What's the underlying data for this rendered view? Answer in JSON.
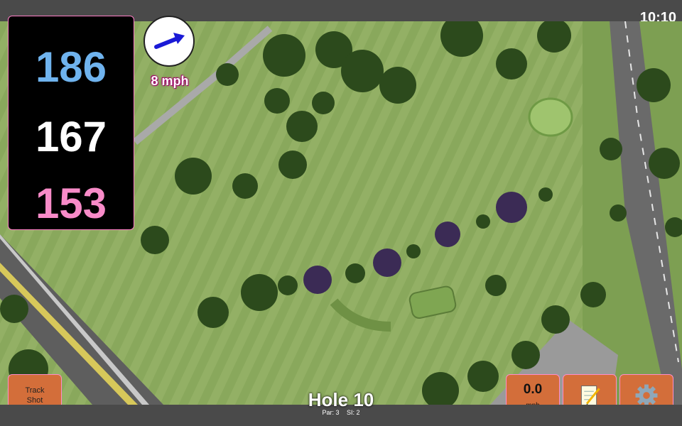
{
  "status_bar": {
    "time": "10:10"
  },
  "distances": {
    "back": "186",
    "center": "167",
    "front": "153"
  },
  "wind": {
    "speed": "8 mph",
    "direction_icon": "wind-arrow-icon"
  },
  "buttons": {
    "track_shot": "Track\nShot",
    "speed_value": "0.0",
    "speed_unit": "mph",
    "notes_icon": "notepad-icon",
    "settings_icon": "gear-icon"
  },
  "hole": {
    "title": "Hole 10",
    "par": "Par: 3",
    "si": "SI: 2"
  },
  "colors": {
    "back": "#6fb3ee",
    "center": "#ffffff",
    "front": "#f88bc8",
    "button": "#d36e3a",
    "accent": "#ff8cc8"
  }
}
